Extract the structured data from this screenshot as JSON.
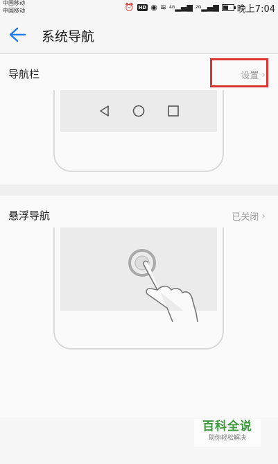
{
  "status_bar": {
    "carrier_1": "中国移动",
    "carrier_2": "中国移动",
    "hd": "HD",
    "sig1": "4G",
    "sig2": "2G",
    "time": "晚上7:04",
    "battery_level": 0.55
  },
  "header": {
    "title": "系统导航"
  },
  "nav_bar_section": {
    "title": "导航栏",
    "value": "设置"
  },
  "float_nav_section": {
    "title": "悬浮导航",
    "value": "已关闭"
  },
  "watermark": {
    "title": "百科全说",
    "subtitle": "助你轻松解决"
  },
  "colors": {
    "accent_blue": "#1e7ae6",
    "highlight_red": "#e03333",
    "watermark_green": "#3a9a3a"
  }
}
